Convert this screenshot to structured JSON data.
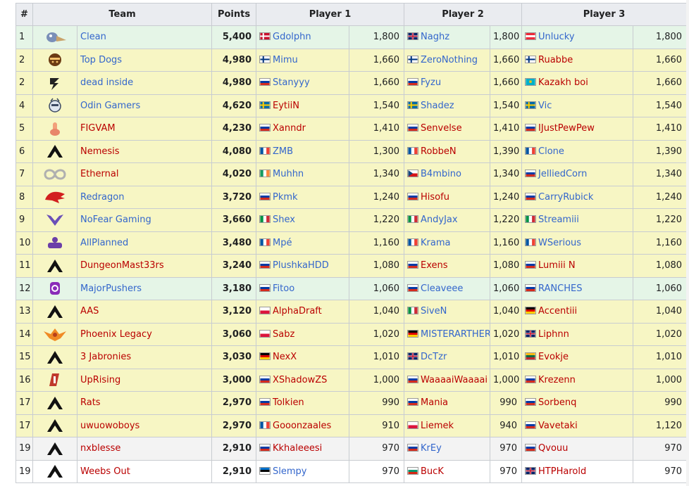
{
  "caption": "",
  "headers": {
    "rank": "#",
    "team": "Team",
    "points": "Points",
    "player1": "Player 1",
    "player2": "Player 2",
    "player3": "Player 3"
  },
  "flag_colors": {
    "dk": [
      "#c8102e",
      "#ffffff"
    ],
    "gb": [
      "#012169",
      "#c8102e"
    ],
    "at": [
      "#ed2939",
      "#ffffff"
    ],
    "fi": [
      "#ffffff",
      "#003580"
    ],
    "ru": [
      "#ffffff",
      "#0039a6",
      "#d52b1e"
    ],
    "kz": [
      "#00afca",
      "#fec50c"
    ],
    "se": [
      "#006aa7",
      "#fecc00"
    ],
    "fr": [
      "#0055a4",
      "#ffffff",
      "#ef4135"
    ],
    "ie": [
      "#169b62",
      "#ffffff",
      "#ff883e"
    ],
    "cz": [
      "#ffffff",
      "#d7141a",
      "#11457e"
    ],
    "it": [
      "#009246",
      "#ffffff",
      "#ce2b37"
    ],
    "pl": [
      "#ffffff",
      "#dc143c"
    ],
    "de": [
      "#000000",
      "#dd0000",
      "#ffce00"
    ],
    "lt": [
      "#fdb913",
      "#006a44",
      "#c1272d"
    ],
    "ee": [
      "#0072ce",
      "#000000",
      "#ffffff"
    ],
    "bg": [
      "#ffffff",
      "#00966e",
      "#d62612"
    ]
  },
  "rows": [
    {
      "rank": "1",
      "logo": "clean-logo",
      "team": "Clean",
      "team_red": false,
      "points": "5,400",
      "style": "up",
      "p1": {
        "flag": "dk",
        "name": "Gdolphn",
        "red": false,
        "pts": "1,800"
      },
      "p2": {
        "flag": "gb",
        "name": "Naghz",
        "red": false,
        "pts": "1,800"
      },
      "p3": {
        "flag": "at",
        "name": "Unlucky",
        "red": false,
        "pts": "1,800"
      }
    },
    {
      "rank": "2",
      "logo": "top-dogs-logo",
      "team": "Top Dogs",
      "team_red": false,
      "points": "4,980",
      "style": "ok",
      "p1": {
        "flag": "fi",
        "name": "Mimu",
        "red": false,
        "pts": "1,660"
      },
      "p2": {
        "flag": "fi",
        "name": "ZeroNothing",
        "red": false,
        "pts": "1,660"
      },
      "p3": {
        "flag": "fi",
        "name": "Ruabbe",
        "red": true,
        "pts": "1,660"
      }
    },
    {
      "rank": "2",
      "logo": "dead-inside-logo",
      "team": "dead inside",
      "team_red": false,
      "points": "4,980",
      "style": "ok",
      "p1": {
        "flag": "ru",
        "name": "Stanyyy",
        "red": false,
        "pts": "1,660"
      },
      "p2": {
        "flag": "ru",
        "name": "Fyzu",
        "red": false,
        "pts": "1,660"
      },
      "p3": {
        "flag": "kz",
        "name": "Kazakh boi",
        "red": true,
        "pts": "1,660"
      }
    },
    {
      "rank": "4",
      "logo": "odin-gamers-logo",
      "team": "Odin Gamers",
      "team_red": false,
      "points": "4,620",
      "style": "ok",
      "p1": {
        "flag": "se",
        "name": "EytiiN",
        "red": true,
        "pts": "1,540"
      },
      "p2": {
        "flag": "se",
        "name": "Shadez",
        "red": false,
        "pts": "1,540"
      },
      "p3": {
        "flag": "se",
        "name": "Vic",
        "red": false,
        "pts": "1,540"
      }
    },
    {
      "rank": "5",
      "logo": "figvam-logo",
      "team": "FIGVAM",
      "team_red": true,
      "points": "4,230",
      "style": "ok",
      "p1": {
        "flag": "ru",
        "name": "Xanndr",
        "red": true,
        "pts": "1,410"
      },
      "p2": {
        "flag": "ru",
        "name": "Senvelse",
        "red": true,
        "pts": "1,410"
      },
      "p3": {
        "flag": "ru",
        "name": "IJustPewPew",
        "red": true,
        "pts": "1,410"
      }
    },
    {
      "rank": "6",
      "logo": "apex-logo",
      "team": "Nemesis",
      "team_red": true,
      "points": "4,080",
      "style": "ok",
      "p1": {
        "flag": "fr",
        "name": "ZMB",
        "red": false,
        "pts": "1,300"
      },
      "p2": {
        "flag": "fr",
        "name": "RobbeN",
        "red": true,
        "pts": "1,390"
      },
      "p3": {
        "flag": "fr",
        "name": "Clone",
        "red": false,
        "pts": "1,390"
      }
    },
    {
      "rank": "7",
      "logo": "ethernal-logo",
      "team": "Ethernal",
      "team_red": true,
      "points": "4,020",
      "style": "ok",
      "p1": {
        "flag": "ie",
        "name": "Muhhn",
        "red": false,
        "pts": "1,340"
      },
      "p2": {
        "flag": "cz",
        "name": "B4mbino",
        "red": false,
        "pts": "1,340"
      },
      "p3": {
        "flag": "ru",
        "name": "JelliedCorn",
        "red": false,
        "pts": "1,340"
      }
    },
    {
      "rank": "8",
      "logo": "redragon-logo",
      "team": "Redragon",
      "team_red": false,
      "points": "3,720",
      "style": "ok",
      "p1": {
        "flag": "ru",
        "name": "Pkmk",
        "red": false,
        "pts": "1,240"
      },
      "p2": {
        "flag": "ru",
        "name": "Hisofu",
        "red": true,
        "pts": "1,240"
      },
      "p3": {
        "flag": "ru",
        "name": "CarryRubick",
        "red": false,
        "pts": "1,240"
      }
    },
    {
      "rank": "9",
      "logo": "nofear-logo",
      "team": "NoFear Gaming",
      "team_red": false,
      "points": "3,660",
      "style": "ok",
      "p1": {
        "flag": "it",
        "name": "Shex",
        "red": false,
        "pts": "1,220"
      },
      "p2": {
        "flag": "it",
        "name": "AndyJax",
        "red": false,
        "pts": "1,220"
      },
      "p3": {
        "flag": "it",
        "name": "Streamiii",
        "red": false,
        "pts": "1,220"
      }
    },
    {
      "rank": "10",
      "logo": "allplanned-logo",
      "team": "AllPlanned",
      "team_red": false,
      "points": "3,480",
      "style": "ok",
      "p1": {
        "flag": "fr",
        "name": "Mpé",
        "red": false,
        "pts": "1,160"
      },
      "p2": {
        "flag": "fr",
        "name": "Krama",
        "red": false,
        "pts": "1,160"
      },
      "p3": {
        "flag": "fr",
        "name": "WSerious",
        "red": false,
        "pts": "1,160"
      }
    },
    {
      "rank": "11",
      "logo": "apex-logo",
      "team": "DungeonMast33rs",
      "team_red": true,
      "points": "3,240",
      "style": "ok",
      "p1": {
        "flag": "ru",
        "name": "PlushkaHDD",
        "red": false,
        "pts": "1,080"
      },
      "p2": {
        "flag": "ru",
        "name": "Exens",
        "red": true,
        "pts": "1,080"
      },
      "p3": {
        "flag": "ru",
        "name": "Lumiii N",
        "red": true,
        "pts": "1,080"
      }
    },
    {
      "rank": "12",
      "logo": "majorpushers-logo",
      "team": "MajorPushers",
      "team_red": false,
      "points": "3,180",
      "style": "up",
      "p1": {
        "flag": "ru",
        "name": "Fitoo",
        "red": false,
        "pts": "1,060"
      },
      "p2": {
        "flag": "ru",
        "name": "Cleaveee",
        "red": false,
        "pts": "1,060"
      },
      "p3": {
        "flag": "ru",
        "name": "RANCHES",
        "red": false,
        "pts": "1,060"
      }
    },
    {
      "rank": "13",
      "logo": "apex-logo",
      "team": "AAS",
      "team_red": true,
      "points": "3,120",
      "style": "ok",
      "p1": {
        "flag": "pl",
        "name": "AlphaDraft",
        "red": true,
        "pts": "1,040"
      },
      "p2": {
        "flag": "it",
        "name": "SiveN",
        "red": false,
        "pts": "1,040"
      },
      "p3": {
        "flag": "de",
        "name": "Accentiii",
        "red": true,
        "pts": "1,040"
      }
    },
    {
      "rank": "14",
      "logo": "phoenix-logo",
      "team": "Phoenix Legacy",
      "team_red": true,
      "points": "3,060",
      "style": "ok",
      "p1": {
        "flag": "pl",
        "name": "Sabz",
        "red": true,
        "pts": "1,020"
      },
      "p2": {
        "flag": "de",
        "name": "MISTERARTHER",
        "red": false,
        "pts": "1,020"
      },
      "p3": {
        "flag": "gb",
        "name": "Liphnn",
        "red": true,
        "pts": "1,020"
      }
    },
    {
      "rank": "15",
      "logo": "apex-logo",
      "team": "3 Jabronies",
      "team_red": true,
      "points": "3,030",
      "style": "ok",
      "p1": {
        "flag": "de",
        "name": "NexX",
        "red": true,
        "pts": "1,010"
      },
      "p2": {
        "flag": "gb",
        "name": "DcTzr",
        "red": false,
        "pts": "1,010"
      },
      "p3": {
        "flag": "lt",
        "name": "Evokje",
        "red": true,
        "pts": "1,010"
      }
    },
    {
      "rank": "16",
      "logo": "uprising-logo",
      "team": "UpRising",
      "team_red": true,
      "points": "3,000",
      "style": "ok",
      "p1": {
        "flag": "ru",
        "name": "XShadowZS",
        "red": true,
        "pts": "1,000"
      },
      "p2": {
        "flag": "ru",
        "name": "WaaaaiWaaaai",
        "red": true,
        "pts": "1,000"
      },
      "p3": {
        "flag": "ru",
        "name": "Krezenn",
        "red": true,
        "pts": "1,000"
      }
    },
    {
      "rank": "17",
      "logo": "apex-logo",
      "team": "Rats",
      "team_red": true,
      "points": "2,970",
      "style": "ok",
      "p1": {
        "flag": "ru",
        "name": "Tolkien",
        "red": true,
        "pts": "990"
      },
      "p2": {
        "flag": "ru",
        "name": "Mania",
        "red": true,
        "pts": "990"
      },
      "p3": {
        "flag": "ru",
        "name": "Sorbenq",
        "red": true,
        "pts": "990"
      }
    },
    {
      "rank": "17",
      "logo": "apex-logo",
      "team": "uwuowoboys",
      "team_red": true,
      "points": "2,970",
      "style": "ok",
      "p1": {
        "flag": "fr",
        "name": "Gooonzaales",
        "red": true,
        "pts": "910"
      },
      "p2": {
        "flag": "pl",
        "name": "Liemek",
        "red": true,
        "pts": "940"
      },
      "p3": {
        "flag": "ru",
        "name": "Vavetaki",
        "red": true,
        "pts": "1,120"
      }
    },
    {
      "rank": "19",
      "logo": "apex-logo",
      "team": "nxblesse",
      "team_red": true,
      "points": "2,910",
      "style": "mid",
      "p1": {
        "flag": "ru",
        "name": "Kkhaleeesi",
        "red": true,
        "pts": "970"
      },
      "p2": {
        "flag": "ru",
        "name": "KrEy",
        "red": false,
        "pts": "970"
      },
      "p3": {
        "flag": "ru",
        "name": "Qvouu",
        "red": true,
        "pts": "970"
      }
    },
    {
      "rank": "19",
      "logo": "apex-logo",
      "team": "Weebs Out",
      "team_red": true,
      "points": "2,910",
      "style": "low",
      "p1": {
        "flag": "ee",
        "name": "Slempy",
        "red": false,
        "pts": "970"
      },
      "p2": {
        "flag": "bg",
        "name": "BucK",
        "red": true,
        "pts": "970"
      },
      "p3": {
        "flag": "gb",
        "name": "HTPHarold",
        "red": true,
        "pts": "970"
      }
    }
  ]
}
